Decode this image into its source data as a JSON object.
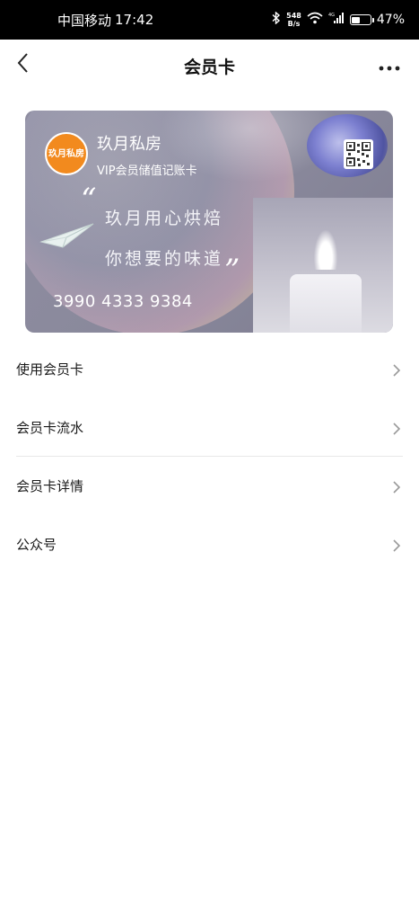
{
  "status_bar": {
    "carrier": "中国移动",
    "time": "17:42",
    "net_speed_value": "548",
    "net_speed_unit": "B/s",
    "battery_percent": "47%",
    "battery_level": 0.47
  },
  "nav": {
    "title": "会员卡",
    "back_icon": "chevron-left-icon",
    "more_icon": "more-dots-icon"
  },
  "card": {
    "logo_text": "玖月私房",
    "name": "玖月私房",
    "subtitle": "VIP会员储值记账卡",
    "slogan_line1": "玖月用心烘焙",
    "slogan_line2": "你想要的味道",
    "quote_open": "“",
    "quote_close": "”",
    "number": "3990 4333 9384",
    "qr_icon": "qr-code-icon"
  },
  "menu": [
    {
      "label": "使用会员卡",
      "icon": "chevron-right-icon"
    },
    {
      "label": "会员卡流水",
      "icon": "chevron-right-icon"
    },
    {
      "label": "会员卡详情",
      "icon": "chevron-right-icon"
    },
    {
      "label": "公众号",
      "icon": "chevron-right-icon"
    }
  ]
}
